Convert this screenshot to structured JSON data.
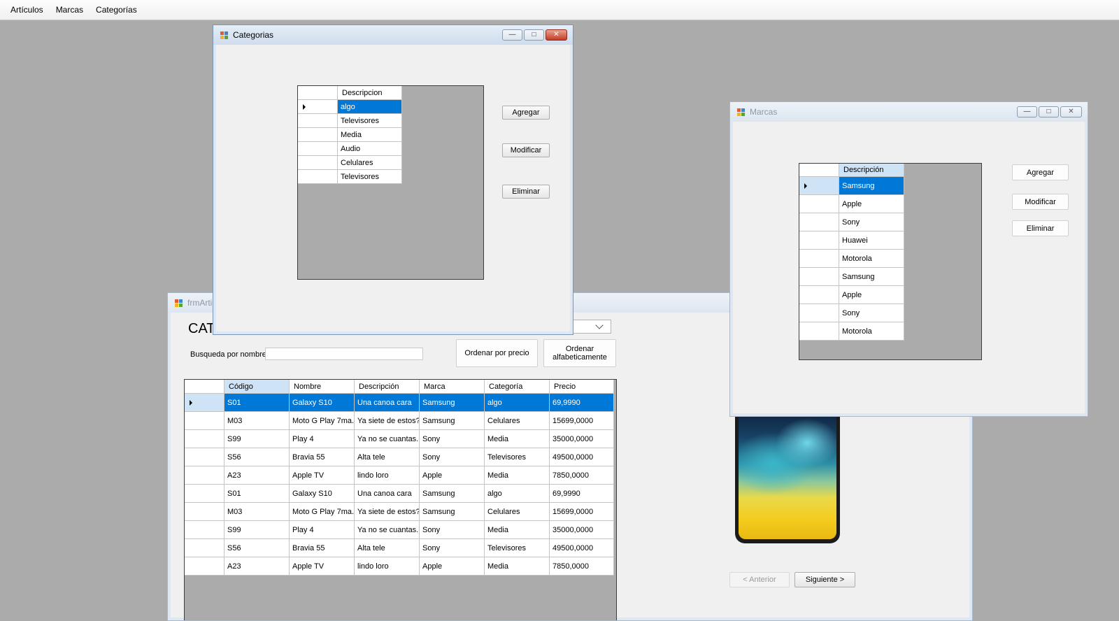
{
  "menu": [
    "Artículos",
    "Marcas",
    "Categorías"
  ],
  "main_window": {
    "title": "frmArtic",
    "heading": "CAT",
    "search_label": "Busqueda por nombre",
    "search_value": "",
    "sort_price_button": "Ordenar por precio",
    "sort_alpha_button_line1": "Ordenar",
    "sort_alpha_button_line2": "alfabeticamente",
    "prev_button": "< Anterior",
    "next_button": "Siguiente >",
    "grid": {
      "columns": [
        "Código",
        "Nombre",
        "Descripción",
        "Marca",
        "Categoría",
        "Precio"
      ],
      "rows": [
        [
          "S01",
          "Galaxy S10",
          "Una canoa cara",
          "Samsung",
          "algo",
          "69,9990"
        ],
        [
          "M03",
          "Moto G Play 7ma...",
          "Ya siete de estos?",
          "Samsung",
          "Celulares",
          "15699,0000"
        ],
        [
          "S99",
          "Play 4",
          "Ya no se cuantas...",
          "Sony",
          "Media",
          "35000,0000"
        ],
        [
          "S56",
          "Bravia 55",
          "Alta tele",
          "Sony",
          "Televisores",
          "49500,0000"
        ],
        [
          "A23",
          "Apple TV",
          "lindo loro",
          "Apple",
          "Media",
          "7850,0000"
        ],
        [
          "S01",
          "Galaxy S10",
          "Una canoa cara",
          "Samsung",
          "algo",
          "69,9990"
        ],
        [
          "M03",
          "Moto G Play 7ma...",
          "Ya siete de estos?",
          "Samsung",
          "Celulares",
          "15699,0000"
        ],
        [
          "S99",
          "Play 4",
          "Ya no se cuantas...",
          "Sony",
          "Media",
          "35000,0000"
        ],
        [
          "S56",
          "Bravia 55",
          "Alta tele",
          "Sony",
          "Televisores",
          "49500,0000"
        ],
        [
          "A23",
          "Apple TV",
          "lindo loro",
          "Apple",
          "Media",
          "7850,0000"
        ]
      ]
    }
  },
  "categorias_window": {
    "title": "Categorias",
    "column": "Descripcion",
    "rows": [
      "algo",
      "Televisores",
      "Media",
      "Audio",
      "Celulares",
      "Televisores"
    ],
    "add_button": "Agregar",
    "edit_button": "Modificar",
    "delete_button": "Eliminar"
  },
  "marcas_window": {
    "title": "Marcas",
    "column": "Descripción",
    "rows": [
      "Samsung",
      "Apple",
      "Sony",
      "Huawei",
      "Motorola",
      "Samsung",
      "Apple",
      "Sony",
      "Motorola"
    ],
    "add_button": "Agregar",
    "edit_button": "Modificar",
    "delete_button": "Eliminar"
  },
  "colors": {
    "selection": "#0078d7",
    "mdi_background": "#ababab",
    "close_button": "#c43c22"
  },
  "icons": [
    "app-icon",
    "minimize-icon",
    "maximize-icon",
    "close-icon",
    "row-pointer-icon",
    "dropdown-arrow-icon"
  ]
}
